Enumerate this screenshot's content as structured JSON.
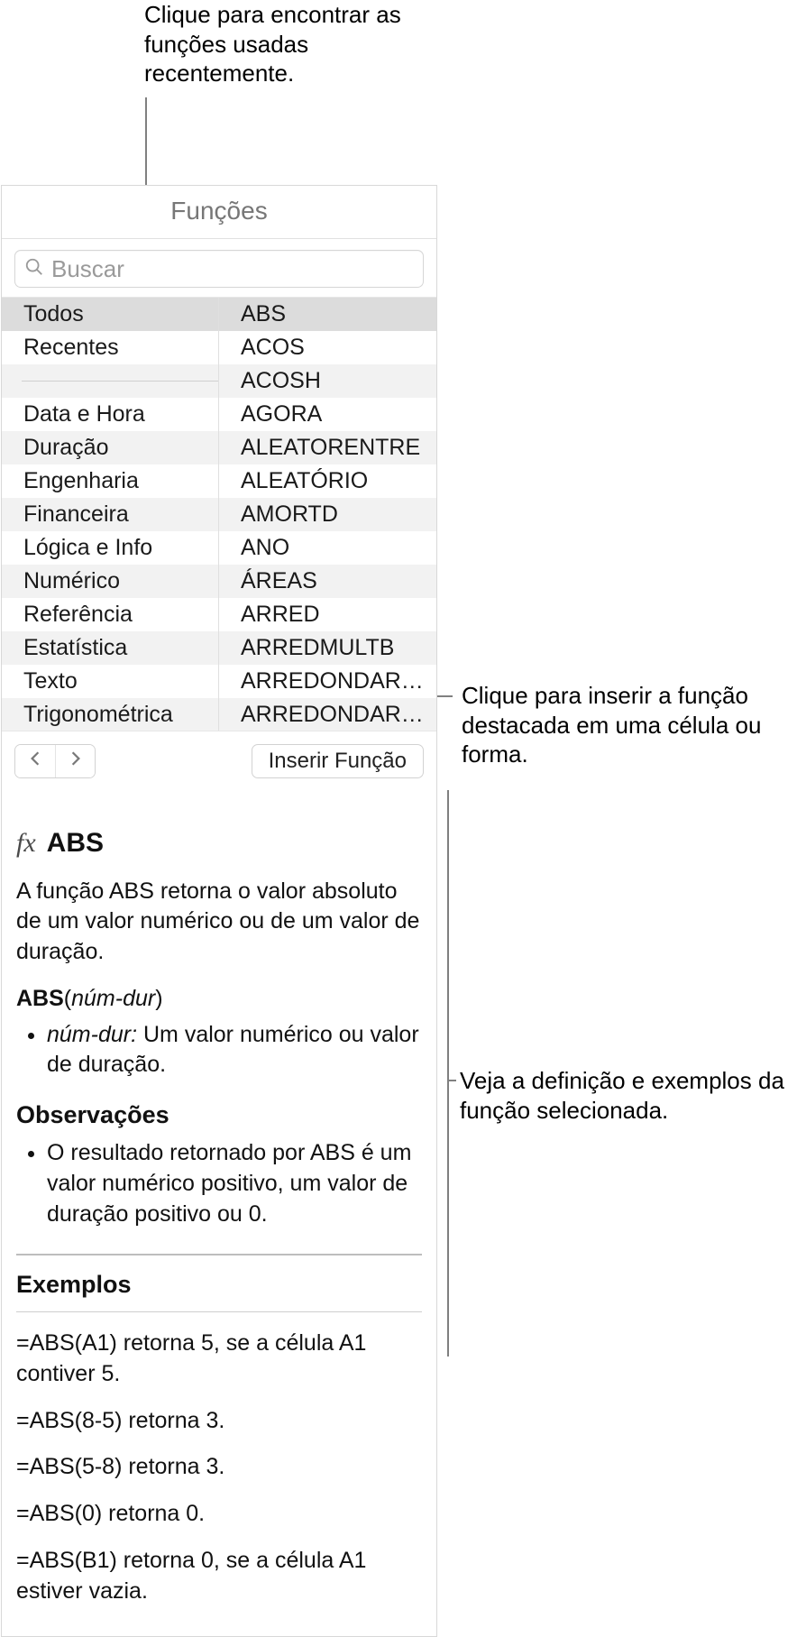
{
  "callouts": {
    "top": "Clique para encontrar as funções usadas recentemente.",
    "insert": "Clique para inserir a função destacada em uma célula ou forma.",
    "detail": "Veja a definição e exemplos da função selecionada."
  },
  "panel": {
    "title": "Funções",
    "search_placeholder": "Buscar"
  },
  "categories": [
    "Todos",
    "Recentes",
    "",
    "Data e Hora",
    "Duração",
    "Engenharia",
    "Financeira",
    "Lógica e Info",
    "Numérico",
    "Referência",
    "Estatística",
    "Texto",
    "Trigonométrica"
  ],
  "functions": [
    "ABS",
    "ACOS",
    "ACOSH",
    "AGORA",
    "ALEATORENTRE",
    "ALEATÓRIO",
    "AMORTD",
    "ANO",
    "ÁREAS",
    "ARRED",
    "ARREDMULTB",
    "ARREDONDAR.PA...",
    "ARREDONDAR.PA..."
  ],
  "toolbar": {
    "insert_label": "Inserir Função"
  },
  "detail": {
    "fx": "fx",
    "name": "ABS",
    "description": "A função ABS retorna o valor absoluto de um valor numérico ou de um valor de duração.",
    "signature_fn": "ABS",
    "signature_arg": "núm-dur",
    "arg_name": "núm-dur:",
    "arg_desc": " Um valor numérico ou valor de duração.",
    "notes_heading": "Observações",
    "note1": "O resultado retornado por ABS é um valor numérico positivo, um valor de duração positivo ou 0.",
    "examples_heading": "Exemplos",
    "ex1": "=ABS(A1) retorna 5, se a célula A1 contiver 5.",
    "ex2": "=ABS(8-5) retorna 3.",
    "ex3": "=ABS(5-8) retorna 3.",
    "ex4": "=ABS(0) retorna 0.",
    "ex5": "=ABS(B1) retorna 0, se a célula A1 estiver vazia."
  }
}
